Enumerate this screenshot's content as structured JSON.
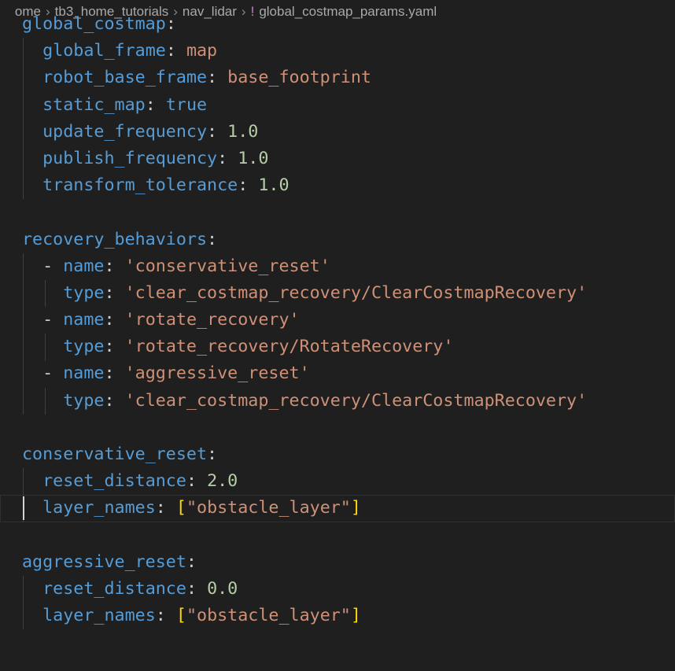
{
  "breadcrumb": {
    "items": [
      "ome",
      "tb3_home_tutorials",
      "nav_lidar",
      "global_costmap_params.yaml"
    ]
  },
  "colors": {
    "background": "#1f1f1f",
    "key": "#569cd6",
    "string": "#ce9178",
    "number": "#b5cea8",
    "bracket": "#ffd700",
    "punctuation": "#cccccc"
  },
  "editor": {
    "language": "yaml",
    "cursor_line": 19,
    "lines": [
      {
        "key": "global_costmap",
        "colon": ":"
      },
      {
        "indent": "  ",
        "key": "global_frame",
        "colon": ": ",
        "value": "map"
      },
      {
        "indent": "  ",
        "key": "robot_base_frame",
        "colon": ": ",
        "value": "base_footprint"
      },
      {
        "indent": "  ",
        "key": "static_map",
        "colon": ": ",
        "value": "true"
      },
      {
        "indent": "  ",
        "key": "update_frequency",
        "colon": ": ",
        "value": "1.0"
      },
      {
        "indent": "  ",
        "key": "publish_frequency",
        "colon": ": ",
        "value": "1.0"
      },
      {
        "indent": "  ",
        "key": "transform_tolerance",
        "colon": ": ",
        "value": "1.0"
      },
      {},
      {
        "key": "recovery_behaviors",
        "colon": ":"
      },
      {
        "indent": "  ",
        "dash": "- ",
        "key": "name",
        "colon": ": ",
        "value": "'conservative_reset'"
      },
      {
        "indent": "    ",
        "key": "type",
        "colon": ": ",
        "value": "'clear_costmap_recovery/ClearCostmapRecovery'"
      },
      {
        "indent": "  ",
        "dash": "- ",
        "key": "name",
        "colon": ": ",
        "value": "'rotate_recovery'"
      },
      {
        "indent": "    ",
        "key": "type",
        "colon": ": ",
        "value": "'rotate_recovery/RotateRecovery'"
      },
      {
        "indent": "  ",
        "dash": "- ",
        "key": "name",
        "colon": ": ",
        "value": "'aggressive_reset'"
      },
      {
        "indent": "    ",
        "key": "type",
        "colon": ": ",
        "value": "'clear_costmap_recovery/ClearCostmapRecovery'"
      },
      {},
      {
        "key": "conservative_reset",
        "colon": ":"
      },
      {
        "indent": "  ",
        "key": "reset_distance",
        "colon": ": ",
        "value": "2.0"
      },
      {
        "indent": "  ",
        "key": "layer_names",
        "colon": ": ",
        "open": "[",
        "value": "\"obstacle_layer\"",
        "close": "]"
      },
      {},
      {
        "key": "aggressive_reset",
        "colon": ":"
      },
      {
        "indent": "  ",
        "key": "reset_distance",
        "colon": ": ",
        "value": "0.0"
      },
      {
        "indent": "  ",
        "key": "layer_names",
        "colon": ": ",
        "open": "[",
        "value": "\"obstacle_layer\"",
        "close": "]"
      }
    ]
  }
}
